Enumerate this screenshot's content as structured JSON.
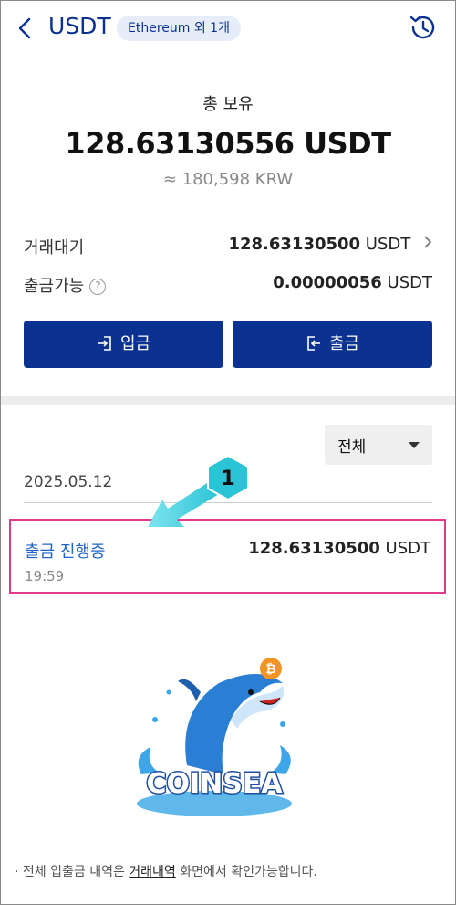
{
  "header": {
    "title": "USDT",
    "network_badge": "Ethereum 외 1개"
  },
  "balance": {
    "label": "총 보유",
    "amount": "128.63130556 USDT",
    "krw": "≈ 180,598 KRW"
  },
  "pending": {
    "label": "거래대기",
    "amount": "128.63130500",
    "unit": "USDT"
  },
  "available": {
    "label": "출금가능",
    "amount": "0.00000056",
    "unit": "USDT"
  },
  "buttons": {
    "deposit": "입금",
    "withdraw": "출금"
  },
  "filter": {
    "selected": "전체"
  },
  "transactions": {
    "date": "2025.05.12",
    "items": [
      {
        "status": "출금 진행중",
        "amount": "128.63130500",
        "unit": "USDT",
        "time": "19:59"
      }
    ]
  },
  "annotation": {
    "step": "1"
  },
  "logo": {
    "text": "COINSEA",
    "coin_symbol": "₿"
  },
  "footnote": {
    "prefix": "· 전체 입출금 내역은 ",
    "link": "거래내역",
    "suffix": " 화면에서 확인가능합니다."
  },
  "colors": {
    "primary": "#0b3291",
    "link_blue": "#1f64c8",
    "highlight": "#e23a8a",
    "annotation": "#2bc4d6"
  }
}
